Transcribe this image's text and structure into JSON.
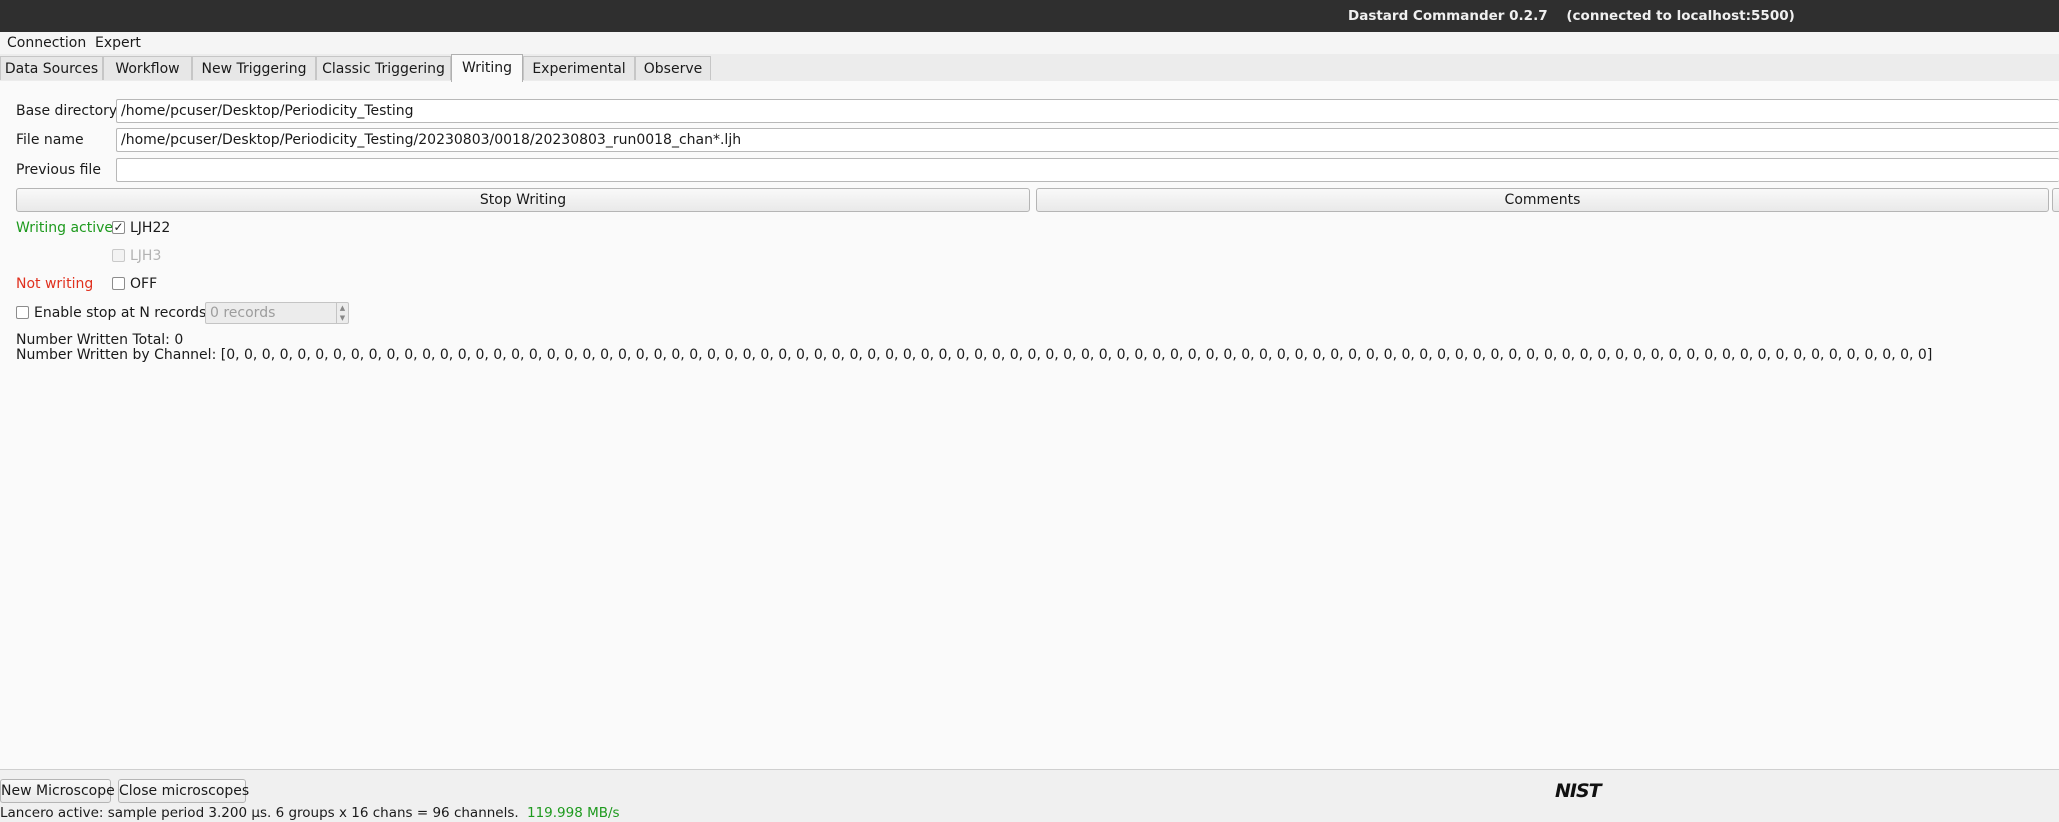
{
  "window": {
    "title": "Dastard Commander 0.2.7    (connected to localhost:5500)"
  },
  "menu": {
    "items": [
      "Connection",
      "Expert"
    ]
  },
  "tabs": {
    "items": [
      "Data Sources",
      "Workflow",
      "New Triggering",
      "Classic Triggering",
      "Writing",
      "Experimental",
      "Observe"
    ],
    "active": "Writing"
  },
  "writing": {
    "base_directory_label": "Base directory",
    "base_directory_value": "/home/pcuser/Desktop/Periodicity_Testing",
    "file_name_label": "File name",
    "file_name_value": "/home/pcuser/Desktop/Periodicity_Testing/20230803/0018/20230803_run0018_chan*.ljh",
    "previous_file_label": "Previous file",
    "previous_file_value": "",
    "stop_button": "Stop Writing",
    "comments_button": "Comments",
    "status_active": "Writing active",
    "status_inactive": "Not writing",
    "format_ljh22": "LJH22",
    "format_ljh3": "LJH3",
    "format_off": "OFF",
    "ljh22_checked": true,
    "ljh3_checked": false,
    "off_checked": false,
    "enable_stop_label": "Enable stop at N records",
    "enable_stop_checked": false,
    "records_placeholder": "0 records",
    "number_written_total": "Number Written Total: 0",
    "number_written_by_channel": "Number Written by Channel: [0, 0, 0, 0, 0, 0, 0, 0, 0, 0, 0, 0, 0, 0, 0, 0, 0, 0, 0, 0, 0, 0, 0, 0, 0, 0, 0, 0, 0, 0, 0, 0, 0, 0, 0, 0, 0, 0, 0, 0, 0, 0, 0, 0, 0, 0, 0, 0, 0, 0, 0, 0, 0, 0, 0, 0, 0, 0, 0, 0, 0, 0, 0, 0, 0, 0, 0, 0, 0, 0, 0, 0, 0, 0, 0, 0, 0, 0, 0, 0, 0, 0, 0, 0, 0, 0, 0, 0, 0, 0, 0, 0, 0, 0, 0, 0]"
  },
  "bottom": {
    "new_microscope_button": "New Microscope",
    "close_microscopes_button": "Close microscopes",
    "logo_text": "NIST",
    "status_prefix": "Lancero active: sample period 3.200 µs.  6 groups x 16 chans = 96 channels.",
    "status_rate": "119.998 MB/s"
  },
  "colors": {
    "active_green": "#1e9a1e",
    "inactive_red": "#e0301e",
    "titlebar_bg": "#2f2f2f"
  }
}
